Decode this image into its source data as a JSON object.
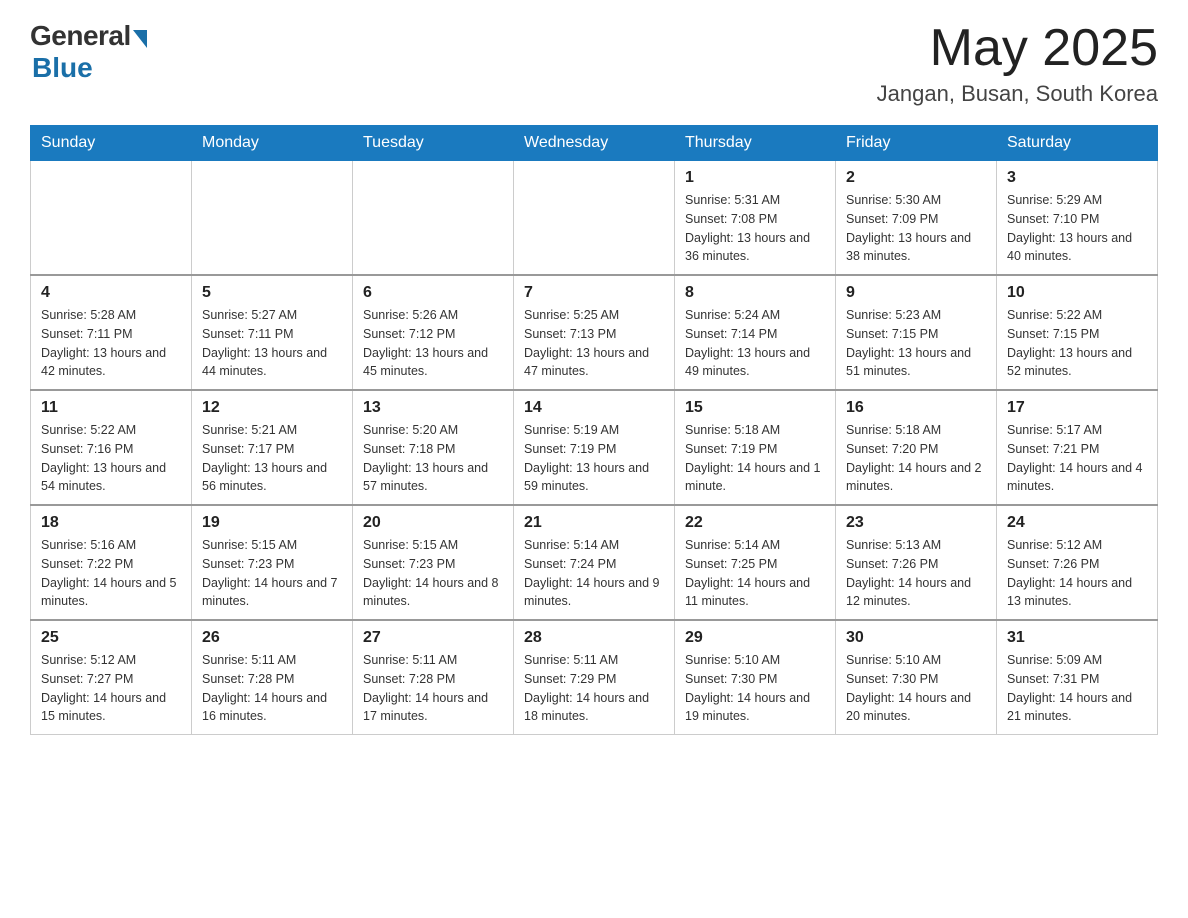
{
  "header": {
    "logo_general": "General",
    "logo_blue": "Blue",
    "month_title": "May 2025",
    "location": "Jangan, Busan, South Korea"
  },
  "days_of_week": [
    "Sunday",
    "Monday",
    "Tuesday",
    "Wednesday",
    "Thursday",
    "Friday",
    "Saturday"
  ],
  "weeks": [
    [
      {
        "day": "",
        "sunrise": "",
        "sunset": "",
        "daylight": ""
      },
      {
        "day": "",
        "sunrise": "",
        "sunset": "",
        "daylight": ""
      },
      {
        "day": "",
        "sunrise": "",
        "sunset": "",
        "daylight": ""
      },
      {
        "day": "",
        "sunrise": "",
        "sunset": "",
        "daylight": ""
      },
      {
        "day": "1",
        "sunrise": "Sunrise: 5:31 AM",
        "sunset": "Sunset: 7:08 PM",
        "daylight": "Daylight: 13 hours and 36 minutes."
      },
      {
        "day": "2",
        "sunrise": "Sunrise: 5:30 AM",
        "sunset": "Sunset: 7:09 PM",
        "daylight": "Daylight: 13 hours and 38 minutes."
      },
      {
        "day": "3",
        "sunrise": "Sunrise: 5:29 AM",
        "sunset": "Sunset: 7:10 PM",
        "daylight": "Daylight: 13 hours and 40 minutes."
      }
    ],
    [
      {
        "day": "4",
        "sunrise": "Sunrise: 5:28 AM",
        "sunset": "Sunset: 7:11 PM",
        "daylight": "Daylight: 13 hours and 42 minutes."
      },
      {
        "day": "5",
        "sunrise": "Sunrise: 5:27 AM",
        "sunset": "Sunset: 7:11 PM",
        "daylight": "Daylight: 13 hours and 44 minutes."
      },
      {
        "day": "6",
        "sunrise": "Sunrise: 5:26 AM",
        "sunset": "Sunset: 7:12 PM",
        "daylight": "Daylight: 13 hours and 45 minutes."
      },
      {
        "day": "7",
        "sunrise": "Sunrise: 5:25 AM",
        "sunset": "Sunset: 7:13 PM",
        "daylight": "Daylight: 13 hours and 47 minutes."
      },
      {
        "day": "8",
        "sunrise": "Sunrise: 5:24 AM",
        "sunset": "Sunset: 7:14 PM",
        "daylight": "Daylight: 13 hours and 49 minutes."
      },
      {
        "day": "9",
        "sunrise": "Sunrise: 5:23 AM",
        "sunset": "Sunset: 7:15 PM",
        "daylight": "Daylight: 13 hours and 51 minutes."
      },
      {
        "day": "10",
        "sunrise": "Sunrise: 5:22 AM",
        "sunset": "Sunset: 7:15 PM",
        "daylight": "Daylight: 13 hours and 52 minutes."
      }
    ],
    [
      {
        "day": "11",
        "sunrise": "Sunrise: 5:22 AM",
        "sunset": "Sunset: 7:16 PM",
        "daylight": "Daylight: 13 hours and 54 minutes."
      },
      {
        "day": "12",
        "sunrise": "Sunrise: 5:21 AM",
        "sunset": "Sunset: 7:17 PM",
        "daylight": "Daylight: 13 hours and 56 minutes."
      },
      {
        "day": "13",
        "sunrise": "Sunrise: 5:20 AM",
        "sunset": "Sunset: 7:18 PM",
        "daylight": "Daylight: 13 hours and 57 minutes."
      },
      {
        "day": "14",
        "sunrise": "Sunrise: 5:19 AM",
        "sunset": "Sunset: 7:19 PM",
        "daylight": "Daylight: 13 hours and 59 minutes."
      },
      {
        "day": "15",
        "sunrise": "Sunrise: 5:18 AM",
        "sunset": "Sunset: 7:19 PM",
        "daylight": "Daylight: 14 hours and 1 minute."
      },
      {
        "day": "16",
        "sunrise": "Sunrise: 5:18 AM",
        "sunset": "Sunset: 7:20 PM",
        "daylight": "Daylight: 14 hours and 2 minutes."
      },
      {
        "day": "17",
        "sunrise": "Sunrise: 5:17 AM",
        "sunset": "Sunset: 7:21 PM",
        "daylight": "Daylight: 14 hours and 4 minutes."
      }
    ],
    [
      {
        "day": "18",
        "sunrise": "Sunrise: 5:16 AM",
        "sunset": "Sunset: 7:22 PM",
        "daylight": "Daylight: 14 hours and 5 minutes."
      },
      {
        "day": "19",
        "sunrise": "Sunrise: 5:15 AM",
        "sunset": "Sunset: 7:23 PM",
        "daylight": "Daylight: 14 hours and 7 minutes."
      },
      {
        "day": "20",
        "sunrise": "Sunrise: 5:15 AM",
        "sunset": "Sunset: 7:23 PM",
        "daylight": "Daylight: 14 hours and 8 minutes."
      },
      {
        "day": "21",
        "sunrise": "Sunrise: 5:14 AM",
        "sunset": "Sunset: 7:24 PM",
        "daylight": "Daylight: 14 hours and 9 minutes."
      },
      {
        "day": "22",
        "sunrise": "Sunrise: 5:14 AM",
        "sunset": "Sunset: 7:25 PM",
        "daylight": "Daylight: 14 hours and 11 minutes."
      },
      {
        "day": "23",
        "sunrise": "Sunrise: 5:13 AM",
        "sunset": "Sunset: 7:26 PM",
        "daylight": "Daylight: 14 hours and 12 minutes."
      },
      {
        "day": "24",
        "sunrise": "Sunrise: 5:12 AM",
        "sunset": "Sunset: 7:26 PM",
        "daylight": "Daylight: 14 hours and 13 minutes."
      }
    ],
    [
      {
        "day": "25",
        "sunrise": "Sunrise: 5:12 AM",
        "sunset": "Sunset: 7:27 PM",
        "daylight": "Daylight: 14 hours and 15 minutes."
      },
      {
        "day": "26",
        "sunrise": "Sunrise: 5:11 AM",
        "sunset": "Sunset: 7:28 PM",
        "daylight": "Daylight: 14 hours and 16 minutes."
      },
      {
        "day": "27",
        "sunrise": "Sunrise: 5:11 AM",
        "sunset": "Sunset: 7:28 PM",
        "daylight": "Daylight: 14 hours and 17 minutes."
      },
      {
        "day": "28",
        "sunrise": "Sunrise: 5:11 AM",
        "sunset": "Sunset: 7:29 PM",
        "daylight": "Daylight: 14 hours and 18 minutes."
      },
      {
        "day": "29",
        "sunrise": "Sunrise: 5:10 AM",
        "sunset": "Sunset: 7:30 PM",
        "daylight": "Daylight: 14 hours and 19 minutes."
      },
      {
        "day": "30",
        "sunrise": "Sunrise: 5:10 AM",
        "sunset": "Sunset: 7:30 PM",
        "daylight": "Daylight: 14 hours and 20 minutes."
      },
      {
        "day": "31",
        "sunrise": "Sunrise: 5:09 AM",
        "sunset": "Sunset: 7:31 PM",
        "daylight": "Daylight: 14 hours and 21 minutes."
      }
    ]
  ]
}
